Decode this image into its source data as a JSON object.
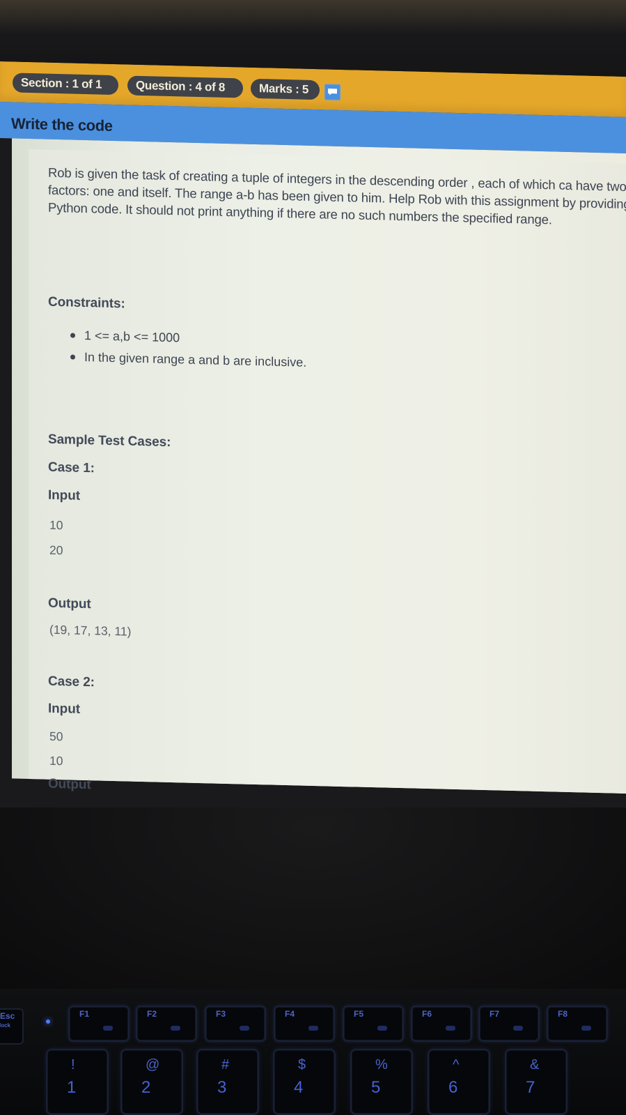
{
  "header": {
    "section": "Section : 1 of 1",
    "question": "Question : 4 of 8",
    "marks": "Marks : 5",
    "marks_icon": "chat-icon"
  },
  "title": "Write the code",
  "problem": {
    "text": "Rob is given the task of creating a tuple of integers in the descending order , each of which ca have two factors: one and itself. The range a-b has been given to him. Help Rob with this assignment by providing Python code. It should not print anything if there are no such numbers the specified range."
  },
  "constraints": {
    "heading": "Constraints:",
    "items": [
      "1 <= a,b <= 1000",
      "In the given range a and b are inclusive."
    ]
  },
  "samples": {
    "heading": "Sample Test Cases:",
    "case1": {
      "label": "Case 1:",
      "input_label": "Input",
      "input": [
        "10",
        "20"
      ],
      "output_label": "Output",
      "output": "(19, 17, 13, 11)"
    },
    "case2": {
      "label": "Case 2:",
      "input_label": "Input",
      "input": [
        "50",
        "10"
      ],
      "output_label": "Output"
    }
  },
  "keyboard": {
    "esc": "Esc",
    "esc_sub": "lock",
    "fkeys": [
      "F1",
      "F2",
      "F3",
      "F4",
      "F5",
      "F6",
      "F7",
      "F8"
    ],
    "number_row_top": [
      "!",
      "@",
      "#",
      "$",
      "%",
      "^",
      "&"
    ],
    "number_row_bottom": [
      "1",
      "2",
      "3",
      "4",
      "5",
      "6",
      "7"
    ]
  }
}
